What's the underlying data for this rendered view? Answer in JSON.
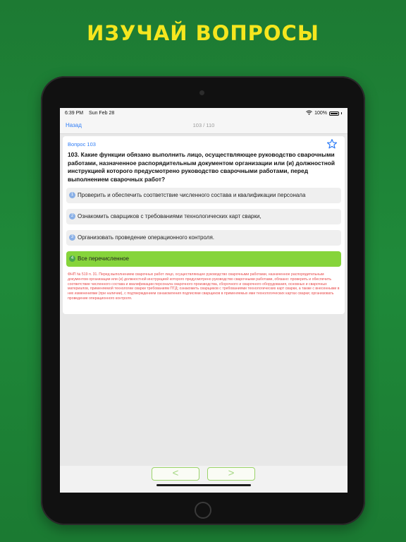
{
  "headline": "ИЗУЧАЙ ВОПРОСЫ",
  "status_bar": {
    "time": "6:39 PM",
    "date": "Sun Feb 28",
    "battery": "100%"
  },
  "nav": {
    "back_label": "Назад",
    "counter": "103 / 110"
  },
  "question": {
    "label": "Вопрос 103",
    "text": "103. Какие функции обязано выполнить лицо, осуществляющее руководство сварочными работами, назначенное распорядительным документом организации или (и) должностной инструкцией которого предусмотрено руководство сварочными работами, перед выполнением сварочных работ?",
    "answers": [
      {
        "num": "1",
        "text": "Проверить и обеспечить соответствие численного состава и квалификации персонала",
        "correct": false
      },
      {
        "num": "2",
        "text": "Ознакомить сварщиков с требованиями технологических карт сварки,",
        "correct": false
      },
      {
        "num": "3",
        "text": "Организовать проведение операционного контроля.",
        "correct": false
      },
      {
        "num": "4",
        "text": "Все перечисленное",
        "correct": true
      }
    ],
    "explanation": "ФНП № 519 п. 31. Перед выполнением сварочных работ лицо, осуществляющее руководство сварочными работами, назначенное распорядительным документом организации или (и) должностной инструкцией которого предусмотрено руководство сварочными работами, обязано: проверить и обеспечить соответствие численного состава и квалификации персонала сварочного производства, сборочного и сварочного оборудования, основных и сварочных материалов, применяемой технологии сварки требованиям ПТД; ознакомить сварщиков с требованиями технологических карт сварки, а также с внесенными в них изменениями (при наличии), с подтверждением ознакомления подписями сварщиков в применяемых ими технологических картах сварки; организовать проведение операционного контроля."
  },
  "bottom": {
    "prev_label": "<",
    "next_label": ">"
  },
  "colors": {
    "background": "#1f8a3a",
    "headline": "#f5e61e",
    "accent": "#2f7df6",
    "correct": "#86d43b",
    "explanation": "#e84a4a"
  }
}
